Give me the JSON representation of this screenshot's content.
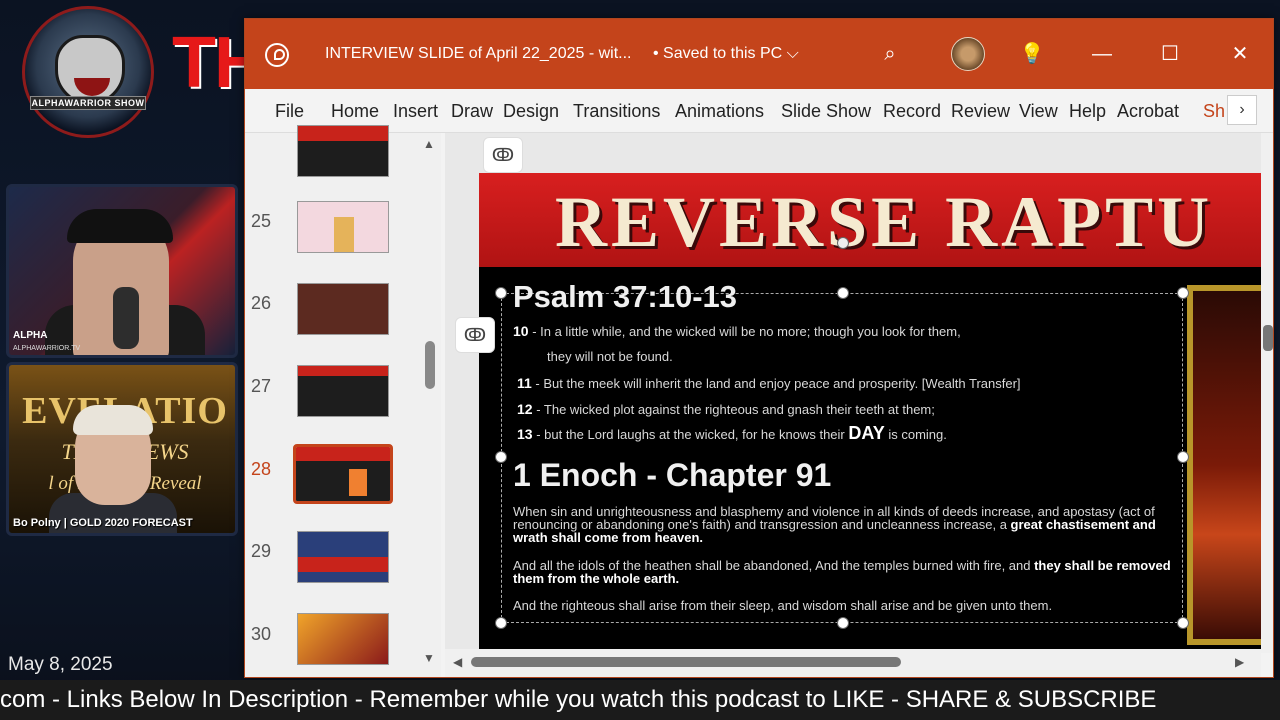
{
  "stream": {
    "logo_text": "ALPHAWARRIOR SHOW",
    "background_title": "TH",
    "host_label": "ALPHA",
    "host_sub": "ALPHAWARRIOR.TV",
    "guest_label": "Bo Polny | GOLD 2020 FORECAST",
    "guest_bg_text_1": "EVELATIO",
    "guest_bg_text_2": "THE GO    EWS",
    "guest_bg_text_3": "l of Days T    e Reveal",
    "date": "May 8, 2025",
    "ticker": "com - Links Below In Description - Remember while you watch this podcast to LIKE - SHARE & SUBSCRIBE"
  },
  "window": {
    "doc_title": "INTERVIEW SLIDE of April 22_2025 - wit...",
    "save_status": "• Saved to this PC",
    "chevron": "⌵",
    "search_icon": "⌕",
    "lightbulb_icon": "💡",
    "minimize": "—",
    "maximize": "☐",
    "close": "✕",
    "accent": "#c4441b"
  },
  "ribbon": {
    "tabs": [
      "File",
      "Home",
      "Insert",
      "Draw",
      "Design",
      "Transitions",
      "Animations",
      "Slide Show",
      "Record",
      "Review",
      "View",
      "Help",
      "Acrobat",
      "Sh"
    ],
    "more": "›"
  },
  "thumbnails": {
    "numbers": [
      "25",
      "26",
      "27",
      "28",
      "29",
      "30"
    ],
    "active": "28"
  },
  "slide": {
    "banner": "REVERSE RAPTU",
    "psalm_title": "Psalm 37:10-13",
    "verses": [
      {
        "num": "10",
        "text": " - In a little while, and the wicked will be no more; though you look for them,"
      },
      {
        "num": "",
        "text": "they will not be found."
      },
      {
        "num": "11",
        "text": " - But the meek will inherit the land and enjoy peace and prosperity.  [Wealth Transfer]"
      },
      {
        "num": "12",
        "text": " - The wicked plot against the righteous and gnash their teeth at them;"
      },
      {
        "num": "13",
        "text": " - but the Lord laughs at the wicked, for he knows their "
      }
    ],
    "day_word": "DAY",
    "day_tail": " is coming.",
    "enoch_title": "1 Enoch - Chapter 91",
    "p1_text": "When sin and unrighteousness and blasphemy and violence in all kinds of deeds increase, and apostasy (act of renouncing or abandoning one's faith) and transgression and uncleanness increase, a ",
    "p1_bold": "great chastisement and wrath shall come from heaven.",
    "p2_text": "And all the idols of the heathen shall be abandoned, And the temples burned with fire, and ",
    "p2_bold": "they shall be removed them from the whole earth.",
    "p3_text": "And the righteous shall arise from their sleep, and wisdom shall arise and be given unto them."
  }
}
